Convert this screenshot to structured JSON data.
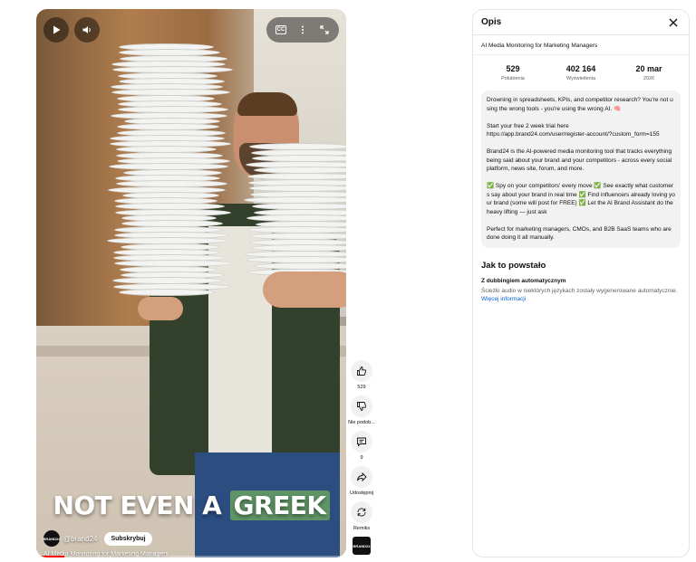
{
  "video": {
    "caption_plain": "NOT EVEN A",
    "caption_highlight": "GREEK",
    "channel_logo_text": "BRAND24",
    "channel_handle": "@brand24",
    "subscribe_label": "Subskrybuj",
    "title": "AI Media Monitoring for Marketing Managers",
    "progress_fraction": 0.09,
    "icons": [
      "play-icon",
      "volume-icon",
      "captions-icon",
      "more-vertical-icon",
      "fullscreen-icon"
    ]
  },
  "actions": {
    "like_count": "529",
    "dislike_label": "Nie podob...",
    "comment_count": "9",
    "share_label": "Udostępnij",
    "remix_label": "Remiks",
    "sound_thumb_text": "BRAND24"
  },
  "panel": {
    "title": "Opis",
    "video_title": "AI Media Monitoring for Marketing Managers",
    "stats": [
      {
        "value": "529",
        "label": "Polubienia"
      },
      {
        "value": "402 164",
        "label": "Wyświetlenia"
      },
      {
        "value": "20 mar",
        "label": "2026"
      }
    ],
    "description": [
      "Drowning in spreadsheets, KPIs, and competitor research? You're not using the wrong tools - you're using the wrong AI. 🧠",
      "Start your free 2 week trial here\nhttps://app.brand24.com/user/register-account/?custom_form=155",
      "Brand24 is the AI-powered media monitoring tool that tracks everything being said about your brand and your competitors - across every social platform, news site, forum, and more.",
      "✅ Spy on your competitors' every move ✅ See exactly what customers say about your brand in real time ✅ Find influencers already loving your brand (some will post for FREE) ✅ Let the AI Brand Assistant do the heavy lifting — just ask",
      "Perfect for marketing managers, CMOs, and B2B SaaS teams who are done doing it all manually."
    ],
    "made_heading": "Jak to powstało",
    "dub_title": "Z dubbingiem automatycznym",
    "dub_text": "Ścieżki audio w niektórych językach zostały wygenerowane automatycznie.",
    "dub_link": "Więcej informacji"
  },
  "colors": {
    "accent_link": "#065fd4",
    "caption_highlight": "#5f9566",
    "progress": "#ff0000"
  }
}
